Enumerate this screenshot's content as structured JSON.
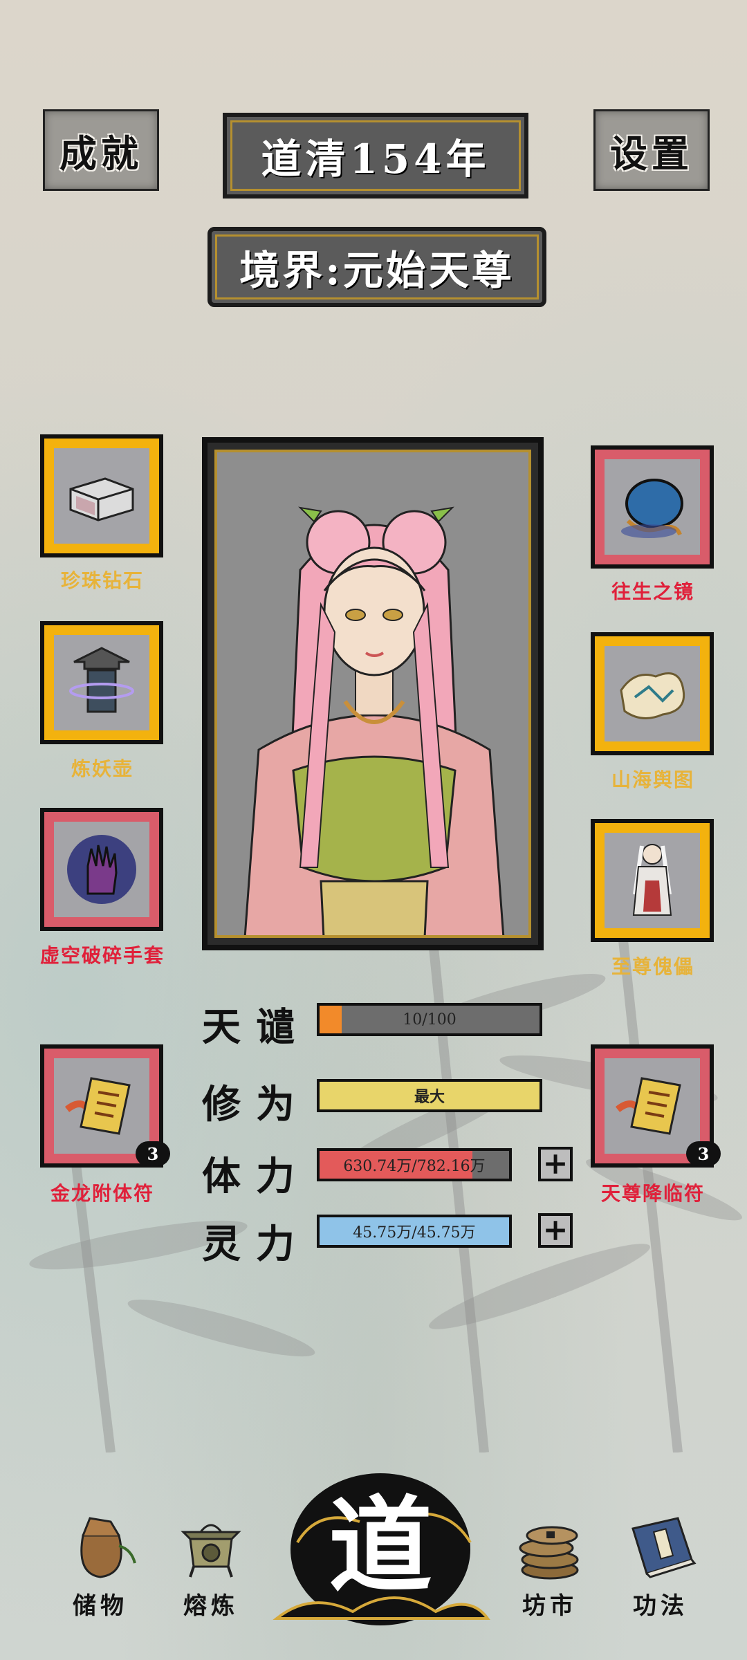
{
  "header": {
    "achievements_label": "成就",
    "year_label": "道清154年",
    "settings_label": "设置",
    "realm_label": "境界:元始天尊"
  },
  "left_slots": [
    {
      "label": "珍珠钻石",
      "frame": "gold",
      "icon": "crystal-box-icon"
    },
    {
      "label": "炼妖壶",
      "frame": "gold",
      "icon": "pagoda-vessel-icon"
    },
    {
      "label": "虚空破碎手套",
      "frame": "red",
      "icon": "void-gauntlet-icon"
    },
    {
      "label": "金龙附体符",
      "frame": "red",
      "icon": "talisman-scroll-icon",
      "count": "3"
    }
  ],
  "right_slots": [
    {
      "label": "往生之镜",
      "frame": "red",
      "icon": "mirror-icon"
    },
    {
      "label": "山海舆图",
      "frame": "gold",
      "icon": "map-scroll-icon"
    },
    {
      "label": "至尊傀儡",
      "frame": "gold",
      "icon": "puppet-icon"
    },
    {
      "label": "天尊降临符",
      "frame": "red",
      "icon": "talisman-scroll-icon",
      "count": "3"
    }
  ],
  "stats": {
    "tianqian": {
      "name": "天谴",
      "value": "10/100",
      "fill": 0.1,
      "color": "#f28a2a"
    },
    "xiuwei": {
      "name": "修为",
      "value": "最大",
      "fill": 1.0,
      "color": "#e8d56a"
    },
    "tili": {
      "name": "体力",
      "value": "630.74万/782.16万",
      "fill": 0.806,
      "color": "#e35a5a"
    },
    "lingli": {
      "name": "灵力",
      "value": "45.75万/45.75万",
      "fill": 1.0,
      "color": "#8fc3e8"
    }
  },
  "nav": {
    "storage": "储物",
    "smelting": "熔炼",
    "center": "道",
    "market": "坊市",
    "skills": "功法"
  },
  "colors": {
    "gold_frame": "#f3b20e",
    "red_frame": "#d95c6a",
    "gold_label": "#e7b33a",
    "red_label": "#e0203a"
  }
}
